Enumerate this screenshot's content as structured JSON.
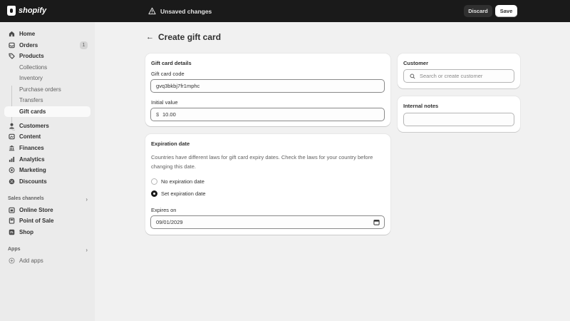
{
  "topbar": {
    "brand": "shopify",
    "unsaved": "Unsaved changes",
    "discard_label": "Discard",
    "save_label": "Save"
  },
  "sidebar": {
    "home": "Home",
    "orders": "Orders",
    "orders_badge": "1",
    "products": "Products",
    "collections": "Collections",
    "inventory": "Inventory",
    "purchase_orders": "Purchase orders",
    "transfers": "Transfers",
    "gift_cards": "Gift cards",
    "customers": "Customers",
    "content": "Content",
    "finances": "Finances",
    "analytics": "Analytics",
    "marketing": "Marketing",
    "discounts": "Discounts",
    "sales_channels": "Sales channels",
    "online_store": "Online Store",
    "point_of_sale": "Point of Sale",
    "shop": "Shop",
    "apps": "Apps",
    "add_apps": "Add apps"
  },
  "page": {
    "title": "Create gift card"
  },
  "details_card": {
    "title": "Gift card details",
    "code_label": "Gift card code",
    "code_value": "gvq3bkbj7fr1mphc",
    "value_label": "Initial value",
    "currency_prefix": "$",
    "value": "10.00"
  },
  "expiration_card": {
    "title": "Expiration date",
    "help": "Countries have different laws for gift card expiry dates. Check the laws for your country before changing this date.",
    "option_none": "No expiration date",
    "option_set": "Set expiration date",
    "selected": "Set expiration date",
    "expires_label": "Expires on",
    "expires_value": "09/01/2029"
  },
  "customer_card": {
    "title": "Customer",
    "search_placeholder": "Search or create customer"
  },
  "notes_card": {
    "title": "Internal notes",
    "value": ""
  }
}
